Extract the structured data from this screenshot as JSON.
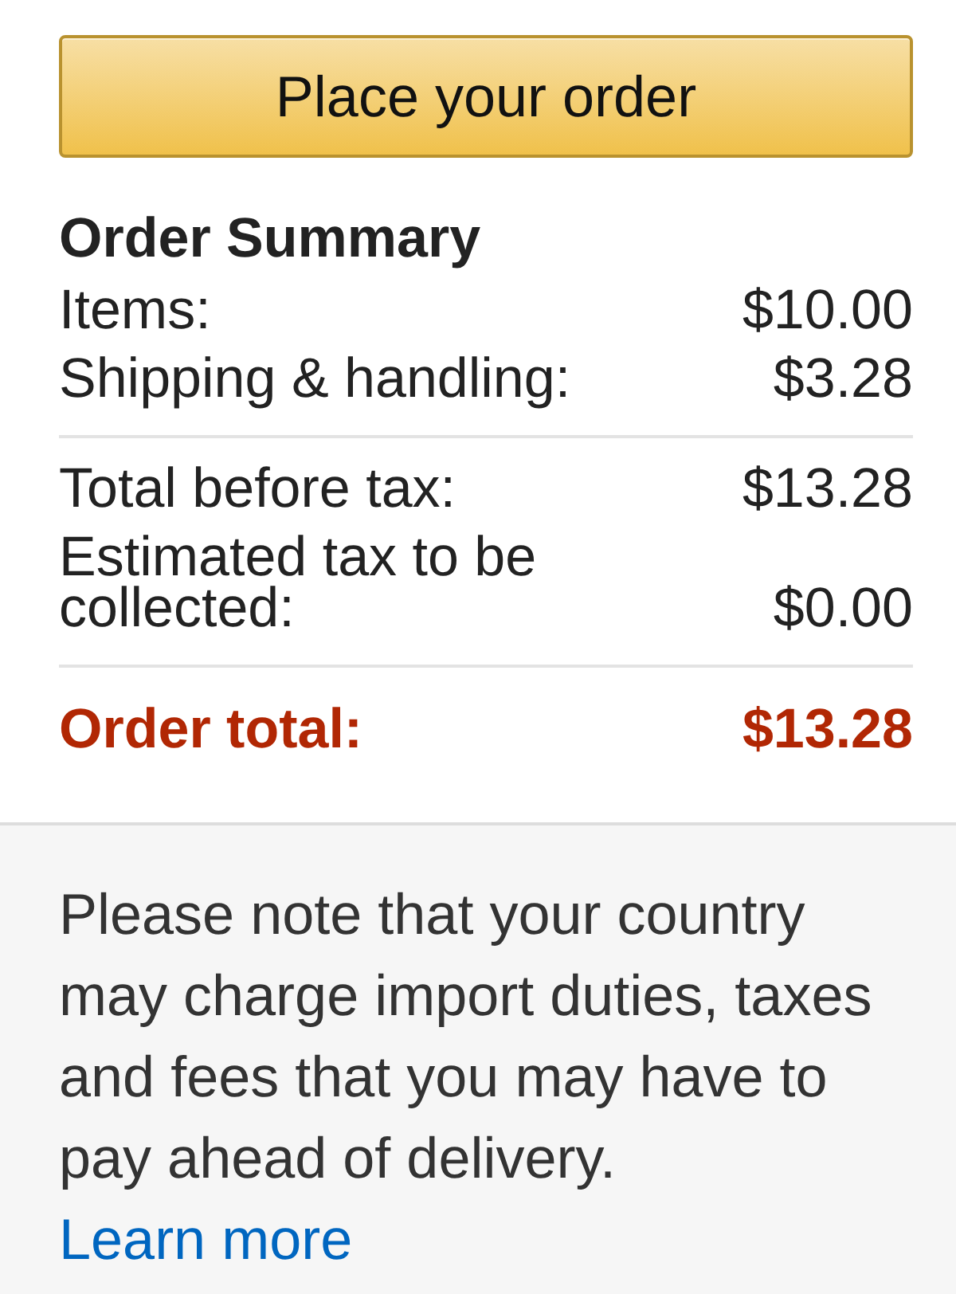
{
  "button": {
    "label": "Place your order"
  },
  "order_summary": {
    "title": "Order Summary",
    "groups": [
      {
        "lines": [
          {
            "label": "Items:",
            "amount": "$10.00"
          },
          {
            "label": "Shipping & handling:",
            "amount": "$3.28"
          }
        ]
      },
      {
        "lines": [
          {
            "label": "Total before tax:",
            "amount": "$13.28"
          },
          {
            "label": "Estimated tax to be collected:",
            "amount": "$0.00"
          }
        ]
      }
    ],
    "total": {
      "label": "Order total:",
      "amount": "$13.28"
    }
  },
  "notice": {
    "text": "Please note that your country may charge import duties, taxes and fees that you may have to pay ahead of delivery.",
    "link": "Learn more"
  }
}
